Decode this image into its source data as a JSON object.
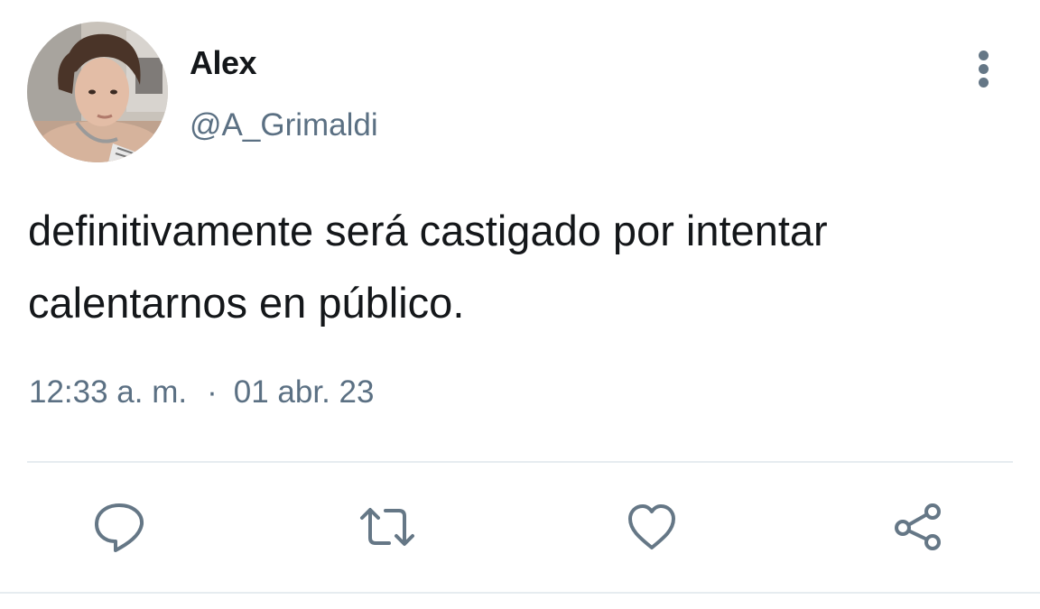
{
  "tweet": {
    "author": {
      "display_name": "Alex",
      "handle": "@A_Grimaldi",
      "avatar": "profile-photo"
    },
    "text_lines": [
      "definitivamente será castigado por intentar",
      "calentarnos en público."
    ],
    "time": "12:33 a. m.",
    "separator": "·",
    "date": "01 abr. 23"
  },
  "actions": [
    {
      "name": "reply",
      "icon": "speech-bubble-icon"
    },
    {
      "name": "retweet",
      "icon": "retweet-arrows-icon"
    },
    {
      "name": "like",
      "icon": "heart-icon"
    },
    {
      "name": "share",
      "icon": "share-nodes-icon"
    }
  ],
  "colors": {
    "text": "#14171a",
    "secondary": "#5b7083",
    "icon": "#657786",
    "divider": "#e6ecf0"
  }
}
